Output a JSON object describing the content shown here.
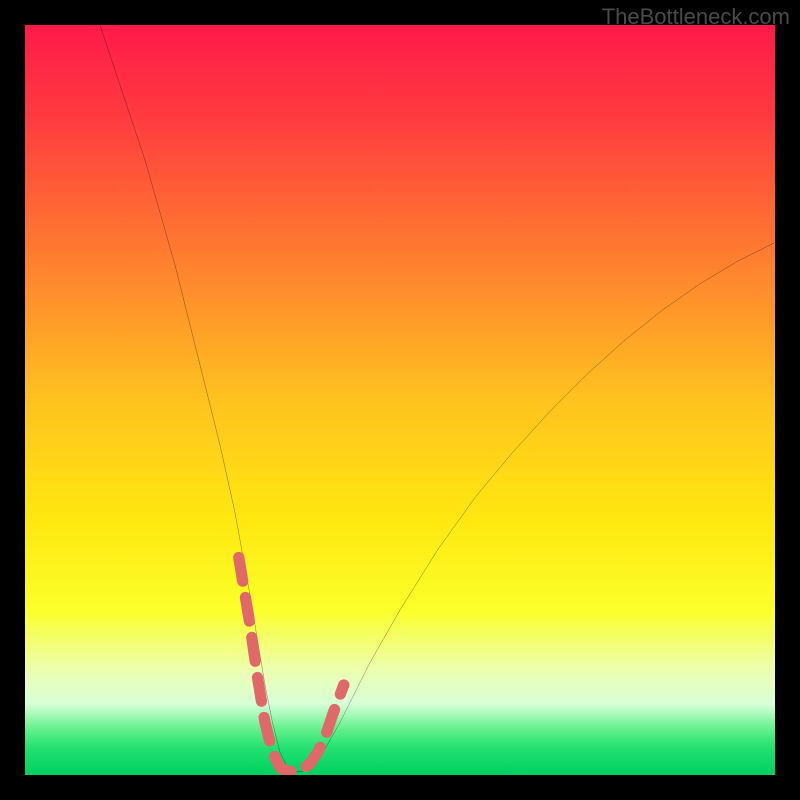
{
  "watermark": "TheBottleneck.com",
  "chart_data": {
    "type": "line",
    "title": "",
    "xlabel": "",
    "ylabel": "",
    "xlim": [
      0,
      100
    ],
    "ylim": [
      0,
      100
    ],
    "grid": false,
    "legend": false,
    "background_gradient": {
      "stops": [
        {
          "offset": 0.0,
          "color": "#ff1a4a"
        },
        {
          "offset": 0.12,
          "color": "#ff3a3f"
        },
        {
          "offset": 0.3,
          "color": "#ff7a30"
        },
        {
          "offset": 0.5,
          "color": "#ffc21f"
        },
        {
          "offset": 0.66,
          "color": "#ffe80f"
        },
        {
          "offset": 0.78,
          "color": "#fbff2a"
        },
        {
          "offset": 0.86,
          "color": "#ecffb0"
        },
        {
          "offset": 0.905,
          "color": "#d8ffd8"
        },
        {
          "offset": 0.94,
          "color": "#60f08a"
        },
        {
          "offset": 0.965,
          "color": "#20e070"
        },
        {
          "offset": 1.0,
          "color": "#00d060"
        }
      ]
    },
    "series": [
      {
        "name": "bottleneck-curve",
        "color": "#000000",
        "x": [
          10,
          12,
          14,
          16,
          18,
          20,
          22,
          24,
          26,
          28,
          30,
          31,
          32,
          33,
          34,
          35,
          36,
          37,
          38,
          39,
          40,
          42,
          44,
          46,
          50,
          55,
          60,
          65,
          70,
          75,
          80,
          85,
          90,
          95,
          100
        ],
        "y": [
          100,
          94,
          88,
          82,
          75,
          68,
          60,
          52,
          44,
          35,
          24,
          18,
          12,
          7,
          3,
          1,
          0.5,
          0.5,
          1,
          2,
          3.5,
          7,
          11,
          15,
          22,
          30,
          37,
          43,
          48.5,
          53.5,
          58,
          62,
          65.5,
          68.5,
          71
        ]
      },
      {
        "name": "highlight-segment",
        "color": "#e06868",
        "thick": true,
        "x": [
          28.5,
          30,
          31,
          32,
          33,
          34,
          35,
          36,
          37,
          38,
          39,
          40,
          41,
          42.5
        ],
        "y": [
          29,
          20,
          13,
          7,
          3,
          1,
          0.5,
          0.5,
          0.8,
          1.5,
          3,
          5,
          8,
          12
        ]
      }
    ]
  }
}
